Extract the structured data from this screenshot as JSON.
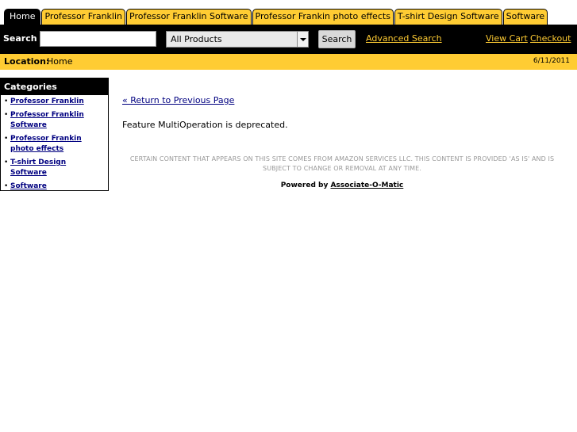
{
  "tabs": [
    "Home",
    "Professor Franklin",
    "Professor Franklin Software",
    "Professor Frankin photo effects",
    "T-shirt Design Software",
    "Software"
  ],
  "header": {
    "search_label": "Search",
    "search_value": "",
    "category_selected": "All Products",
    "search_button": "Search",
    "advanced_search": "Advanced Search",
    "view_cart": "View Cart",
    "checkout": "Checkout"
  },
  "location": {
    "label": "Location:",
    "value": "Home",
    "date": "6/11/2011"
  },
  "sidebar": {
    "title": "Categories",
    "items": [
      "Professor Franklin",
      "Professor Franklin Software",
      "Professor Frankin photo effects",
      "T-shirt Design Software",
      "Software"
    ]
  },
  "main": {
    "back_link": "« Return to Previous Page",
    "message": "Feature MultiOperation is deprecated.",
    "disclaimer": "CERTAIN CONTENT THAT APPEARS ON THIS SITE COMES FROM AMAZON SERVICES LLC. THIS CONTENT IS PROVIDED 'AS IS' AND IS SUBJECT TO CHANGE OR REMOVAL AT ANY TIME.",
    "powered_by_prefix": "Powered by",
    "powered_by_link": "Associate-O-Matic"
  },
  "colors": {
    "accent": "#ffcc33",
    "bar": "#000000",
    "link": "#000080"
  }
}
